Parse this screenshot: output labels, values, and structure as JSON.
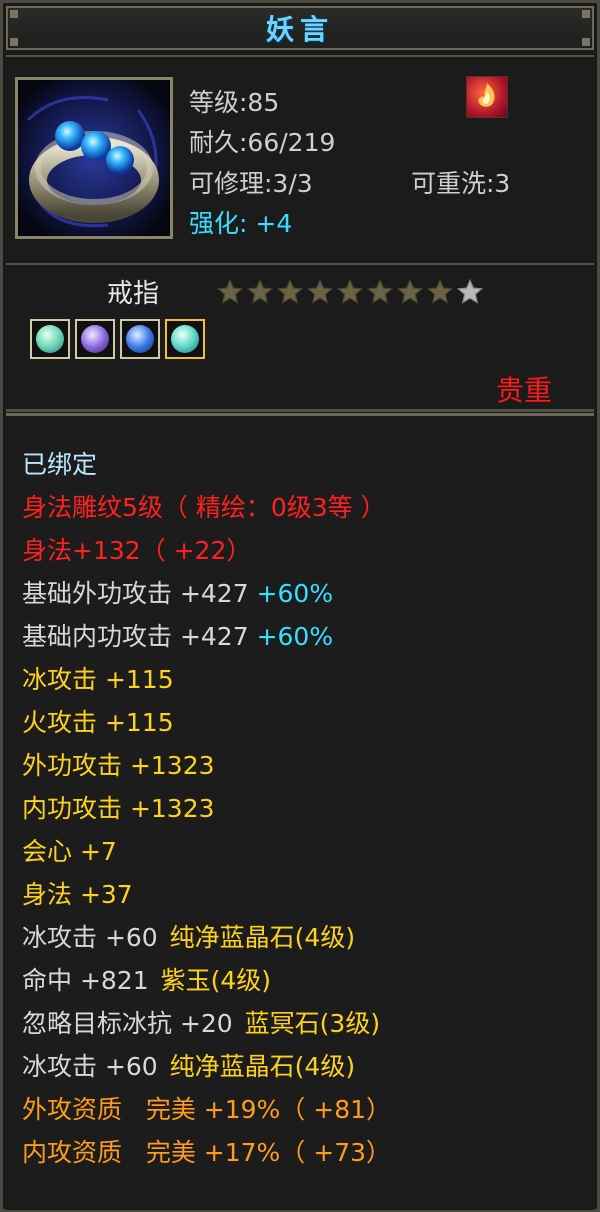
{
  "title": "妖言",
  "header": {
    "level": "等级:85",
    "durability": "耐久:66/219",
    "repairable": "可修理:3/3",
    "rewashable": "可重洗:3",
    "enhance": "强化: +4"
  },
  "item_type": "戒指",
  "stars": {
    "filled": 8,
    "total": 9
  },
  "rarity": "贵重",
  "attributes": [
    {
      "text": "已绑定",
      "color": "bound"
    },
    {
      "text": "身法雕纹5级（ 精绘：0级3等 ）",
      "color": "red"
    },
    {
      "text": "身法+132（ +22）",
      "color": "red"
    },
    {
      "text": "基础外功攻击 +427",
      "extra": "+60%",
      "color": "white"
    },
    {
      "text": "基础内功攻击 +427",
      "extra": "+60%",
      "color": "white"
    },
    {
      "text": "冰攻击 +115",
      "color": "yellow"
    },
    {
      "text": "火攻击 +115",
      "color": "yellow"
    },
    {
      "text": "外功攻击 +1323",
      "color": "yellow"
    },
    {
      "text": "内功攻击 +1323",
      "color": "yellow"
    },
    {
      "text": "会心 +7",
      "color": "yellow"
    },
    {
      "text": "身法 +37",
      "color": "yellow"
    },
    {
      "text": "冰攻击 +60",
      "gem": "纯净蓝晶石(4级)",
      "color": "white"
    },
    {
      "text": "命中 +821",
      "gem": "紫玉(4级)",
      "color": "white"
    },
    {
      "text": "忽略目标冰抗 +20",
      "gem": "蓝冥石(3级)",
      "color": "white"
    },
    {
      "text": "冰攻击 +60",
      "gem": "纯净蓝晶石(4级)",
      "color": "white"
    },
    {
      "text": "外攻资质   完美 +19%（ +81）",
      "color": "orange"
    },
    {
      "text": "内攻资质   完美 +17%（ +73）",
      "color": "orange"
    }
  ],
  "colors": {
    "title": "#6fd3ff",
    "red": "#ff2020",
    "yellow": "#ffd21a",
    "orange": "#ff9c1a",
    "cyan": "#33e0ff"
  },
  "icons": {
    "item": "ring-with-blue-gems-icon",
    "skill": "flame-skill-icon",
    "gems": [
      "green-gem-icon",
      "purple-gem-icon",
      "blue-gem-icon",
      "teal-gem-icon"
    ]
  }
}
